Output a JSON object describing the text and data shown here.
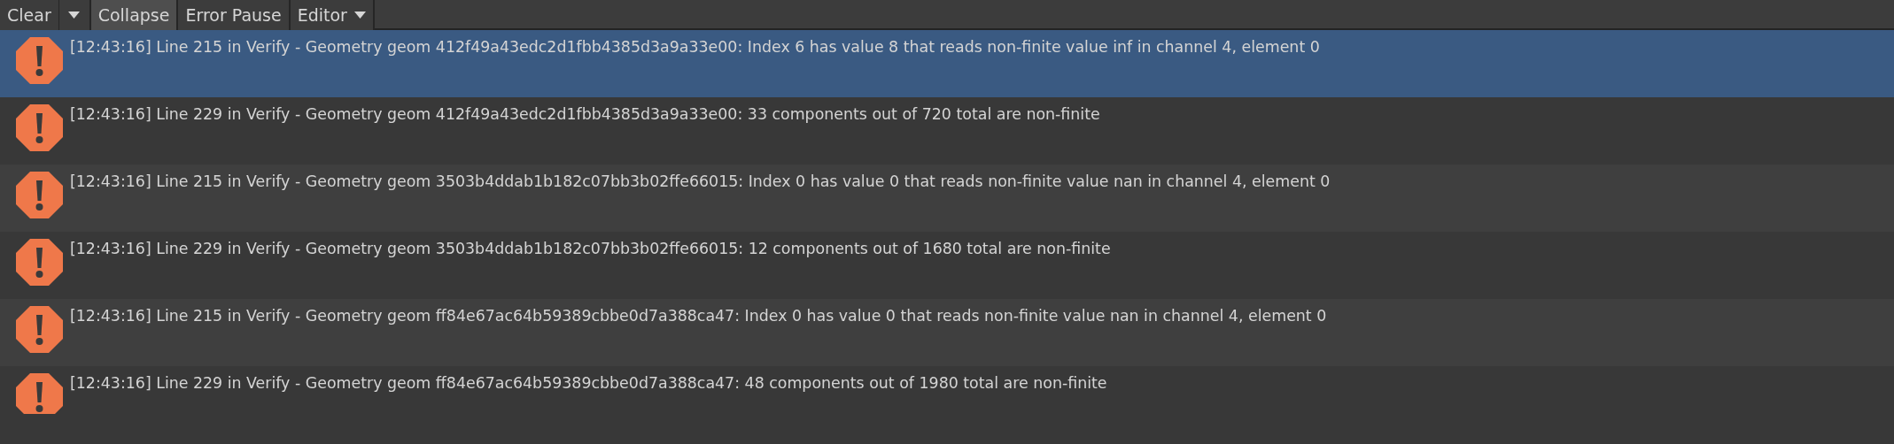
{
  "toolbar": {
    "buttons": [
      {
        "label": "Clear",
        "kind": "button",
        "selected": false
      },
      {
        "label": "Collapse",
        "kind": "toggle",
        "selected": true
      },
      {
        "label": "Error Pause",
        "kind": "toggle",
        "selected": false
      },
      {
        "label": "Editor",
        "kind": "dropdown",
        "selected": false
      }
    ]
  },
  "messages": [
    {
      "kind": "error",
      "selected": true,
      "text": "[12:43:16] Line 215 in Verify - Geometry geom 412f49a43edc2d1fbb4385d3a9a33e00: Index 6 has value 8 that reads non-finite value inf in channel 4, element 0"
    },
    {
      "kind": "error",
      "selected": false,
      "text": "[12:43:16] Line 229 in Verify - Geometry geom 412f49a43edc2d1fbb4385d3a9a33e00: 33 components out of 720 total are non-finite"
    },
    {
      "kind": "error",
      "selected": false,
      "text": "[12:43:16] Line 215 in Verify - Geometry geom 3503b4ddab1b182c07bb3b02ffe66015: Index 0 has value 0 that reads non-finite value nan in channel 4, element 0"
    },
    {
      "kind": "error",
      "selected": false,
      "text": "[12:43:16] Line 229 in Verify - Geometry geom 3503b4ddab1b182c07bb3b02ffe66015: 12 components out of 1680 total are non-finite"
    },
    {
      "kind": "error",
      "selected": false,
      "text": "[12:43:16] Line 215 in Verify - Geometry geom ff84e67ac64b59389cbbe0d7a388ca47: Index 0 has value 0 that reads non-finite value nan in channel 4, element 0"
    },
    {
      "kind": "error",
      "selected": false,
      "text": "[12:43:16] Line 229 in Verify - Geometry geom ff84e67ac64b59389cbbe0d7a388ca47: 48 components out of 1980 total are non-finite"
    }
  ]
}
